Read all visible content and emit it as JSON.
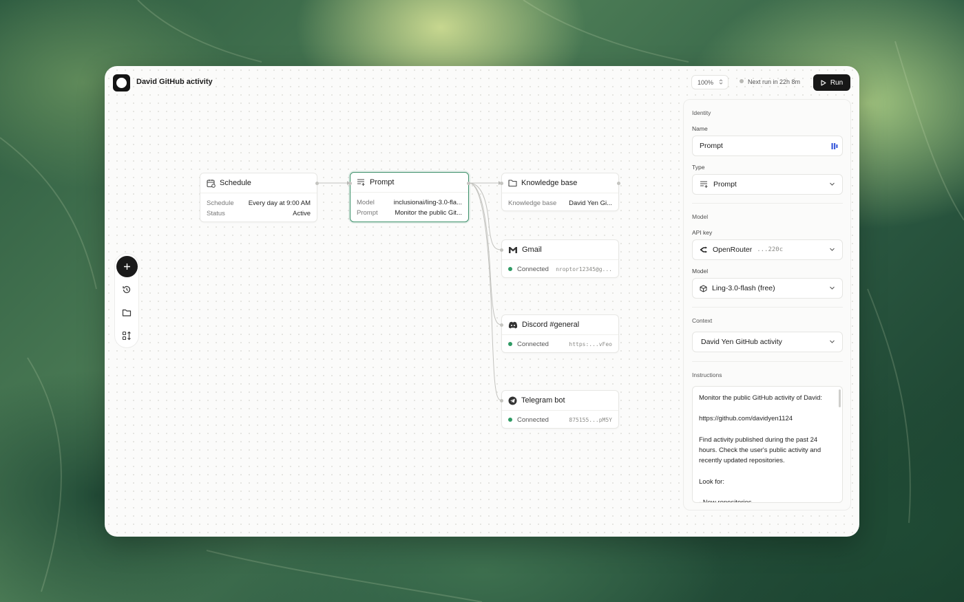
{
  "app": {
    "title": "David GitHub activity"
  },
  "toolbar": {
    "zoom": "100%",
    "next_run": "Next run in 22h 8m",
    "run_label": "Run"
  },
  "nodes": {
    "schedule": {
      "title": "Schedule",
      "rows": [
        {
          "k": "Schedule",
          "v": "Every day at 9:00 AM"
        },
        {
          "k": "Status",
          "v": "Active"
        }
      ]
    },
    "prompt": {
      "title": "Prompt",
      "rows": [
        {
          "k": "Model",
          "v": "inclusionai/ling-3.0-fla..."
        },
        {
          "k": "Prompt",
          "v": "Monitor the public Git..."
        }
      ]
    },
    "knowledge": {
      "title": "Knowledge base",
      "rows": [
        {
          "k": "Knowledge base",
          "v": "David Yen Gi..."
        }
      ]
    },
    "gmail": {
      "title": "Gmail",
      "status": "Connected",
      "detail": "nroptor12345@g..."
    },
    "discord": {
      "title": "Discord #general",
      "status": "Connected",
      "detail": "https:...vFeo"
    },
    "telegram": {
      "title": "Telegram bot",
      "status": "Connected",
      "detail": "875155...pM5Y"
    }
  },
  "panel": {
    "identity_label": "Identity",
    "name_label": "Name",
    "name_value": "Prompt",
    "type_label": "Type",
    "type_value": "Prompt",
    "model_section": "Model",
    "api_key_label": "API key",
    "api_key_provider": "OpenRouter",
    "api_key_suffix": "...220c",
    "model_label": "Model",
    "model_value": "Ling-3.0-flash (free)",
    "context_label": "Context",
    "context_value": "David Yen GitHub activity",
    "instructions_label": "Instructions",
    "instructions": [
      "Monitor the public GitHub activity of David:",
      "https://github.com/davidyen1124",
      "Find activity published during the past 24 hours. Check the user's public activity and recently updated repositories.",
      "Look for:",
      "- New repositories"
    ]
  },
  "colors": {
    "accent_green": "#3a8f68",
    "status_green": "#2f9a64",
    "run_button": "#171717"
  },
  "icons": [
    "app-logo-icon",
    "chevrons-updown-icon",
    "play-icon",
    "plus-icon",
    "history-icon",
    "folder-icon",
    "integrations-icon",
    "calendar-icon",
    "prompt-icon",
    "gmail-icon",
    "discord-icon",
    "telegram-icon",
    "chevron-down-icon",
    "password-manager-icon",
    "openrouter-icon",
    "model-cube-icon"
  ]
}
